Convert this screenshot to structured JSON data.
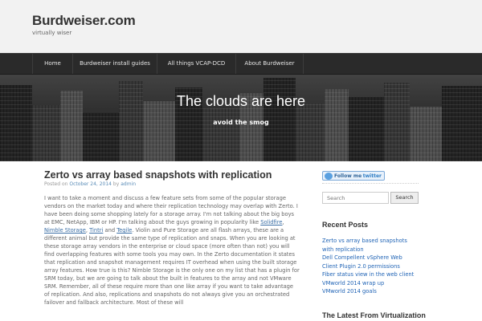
{
  "site": {
    "title": "Burdweiser.com",
    "tagline": "virtually wiser"
  },
  "nav": {
    "items": [
      {
        "label": "Home"
      },
      {
        "label": "Burdweiser install guides"
      },
      {
        "label": "All things VCAP-DCD"
      },
      {
        "label": "About Burdweiser"
      }
    ]
  },
  "hero": {
    "title": "The clouds are here",
    "subtitle": "avoid the smog"
  },
  "post": {
    "title": "Zerto vs array based snapshots with replication",
    "meta_prefix": "Posted on",
    "date": "October 24, 2014",
    "meta_by": "by",
    "author": "admin",
    "body_part1": "I want to take a moment and discuss a few feature sets from some of the popular storage vendors on the market today and where their replication technology may overlap with Zerto. I have been doing some shopping lately for a storage array. I'm not talking about the big boys at EMC, NetApp, IBM or HP. I'm talking about the guys growing in popularity like ",
    "link_solidfire": "Solidfire",
    "sep1": ", ",
    "link_nimble": "Nimble Storage",
    "sep2": ", ",
    "link_tintri": "Tintri",
    "sep3": " and ",
    "link_tegile": "Tegile",
    "body_part2": ". Violin and Pure Storage are all flash arrays, these are a different animal but provide the same type of replication and snaps. When you are looking at these storage array vendors in the enterprise or cloud space (more often than not) you will find overlapping features with some tools you may own. In the Zerto documentation it states that replication and snapshot management requires IT overhead when using the built storage array features. How true is this? Nimble Storage is the only one on my list that has a plugin for SRM today, but we are going to talk about the built in features to the array and not VMware SRM. Remember, all of these require more than one like array if you want to take advantage of replication. And also, replications and snapshots do not always give you an orchestrated failover and fallback architecture. Most of these will"
  },
  "sidebar": {
    "follow_label": "Follow me",
    "follow_brand": "twitter",
    "search_placeholder": "Search",
    "search_button": "Search",
    "recent_title": "Recent Posts",
    "recent_posts": [
      "Zerto vs array based snapshots with replication",
      "Dell Compellent vSphere Web Client Plugin 2.0 permissions",
      "Fiber status view in the web client",
      "VMworld 2014 wrap up",
      "VMworld 2014 goals"
    ],
    "latest_title": "The Latest From Virtualization"
  },
  "colors": {
    "link": "#1f63b5",
    "nav_bg": "#2a2a2a",
    "header_bg": "#f2f2f2"
  }
}
